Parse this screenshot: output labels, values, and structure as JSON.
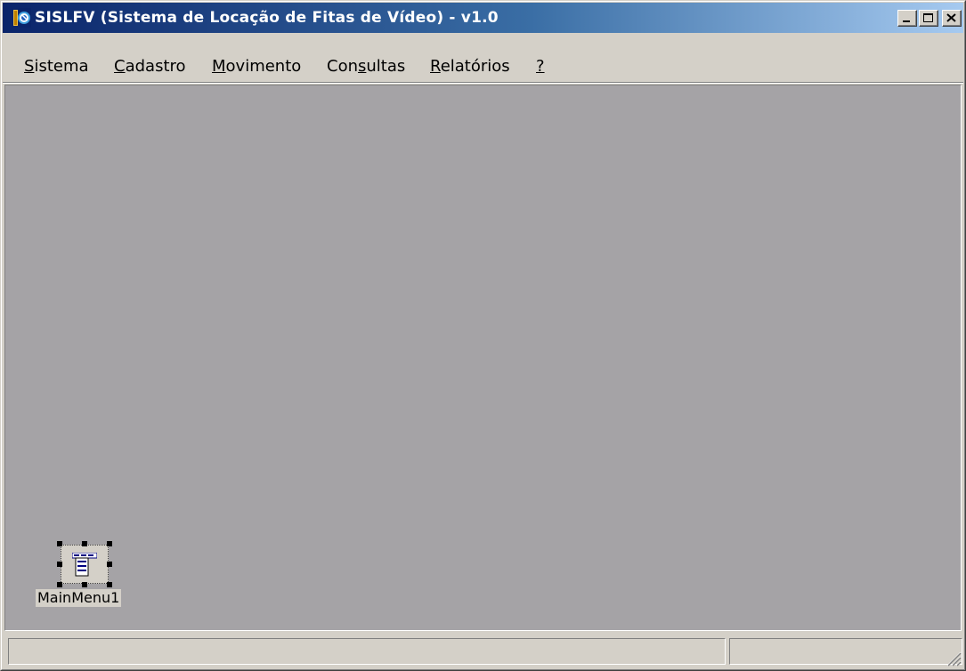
{
  "window": {
    "title": "SISLFV (Sistema de Locação de Fitas de Vídeo) - v1.0",
    "icon": "app-icon"
  },
  "title_buttons": [
    "minimize-icon",
    "maximize-icon",
    "close-icon"
  ],
  "menu": {
    "items": [
      {
        "label_pre": "",
        "label_key": "S",
        "label_post": "istema"
      },
      {
        "label_pre": "",
        "label_key": "C",
        "label_post": "adastro"
      },
      {
        "label_pre": "",
        "label_key": "M",
        "label_post": "ovimento"
      },
      {
        "label_pre": "Con",
        "label_key": "s",
        "label_post": "ultas"
      },
      {
        "label_pre": "",
        "label_key": "R",
        "label_post": "elatórios"
      },
      {
        "label_pre": "",
        "label_key": "?",
        "label_post": ""
      }
    ]
  },
  "designer": {
    "component": {
      "name": "MainMenu1",
      "icon": "main-menu-component-icon"
    },
    "background_color": "#a5a3a6"
  },
  "statusbar": {
    "panels": [
      "",
      ""
    ]
  },
  "colors": {
    "titlebar_start": "#0a246a",
    "titlebar_end": "#a6caf0",
    "face": "#d4d0c8"
  }
}
